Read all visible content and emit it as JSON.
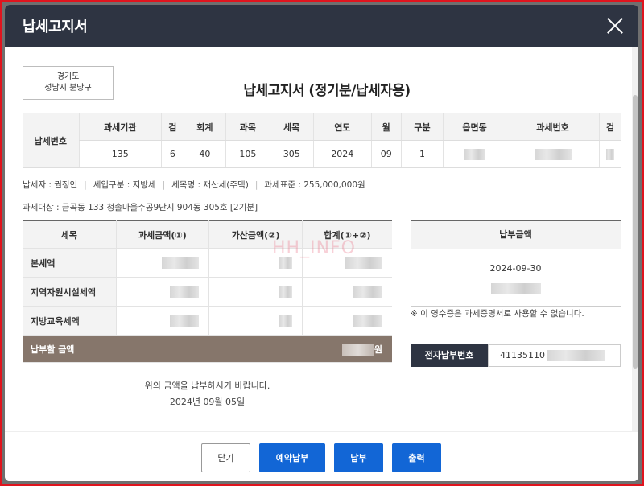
{
  "modal": {
    "title": "납세고지서"
  },
  "region": {
    "line1": "경기도",
    "line2": "성남시 분당구"
  },
  "document_title": "납세고지서 (정기분/납세자용)",
  "tax_number": {
    "label": "납세번호",
    "headers": [
      "과세기관",
      "검",
      "회계",
      "과목",
      "세목",
      "연도",
      "월",
      "구분",
      "읍면동",
      "과세번호",
      "검"
    ],
    "values": [
      "135",
      "6",
      "40",
      "105",
      "305",
      "2024",
      "09",
      "1",
      "",
      "",
      ""
    ]
  },
  "info": {
    "taxpayer": "납세자 : 권정인",
    "category": "세입구분 : 지방세",
    "tax_item": "세목명 : 재산세(주택)",
    "standard": "과세표준 : 255,000,000원",
    "target": "과세대상 : 금곡동 133 청솔마을주공9단지 904동 305호 [2기분]"
  },
  "amount_table": {
    "headers": [
      "세목",
      "과세금액(①)",
      "가산금액(②)",
      "합계(①+②)"
    ],
    "rows": [
      {
        "label": "본세액"
      },
      {
        "label": "지역자원시설세액"
      },
      {
        "label": "지방교육세액"
      }
    ],
    "total_label": "납부할 금액",
    "total_unit": "원"
  },
  "watermark": "HH_INFO",
  "payment": {
    "header": "납부금액",
    "date": "2024-09-30",
    "notice": "※ 이 영수증은 과세증명서로 사용할 수 없습니다.",
    "epay_label": "전자납부번호",
    "epay_value": "41135110"
  },
  "request": {
    "line1": "위의 금액을 납부하시기 바랍니다.",
    "line2": "2024년 09월 05일"
  },
  "buttons": {
    "close": "닫기",
    "reserve": "예약납부",
    "pay": "납부",
    "print": "출력"
  }
}
